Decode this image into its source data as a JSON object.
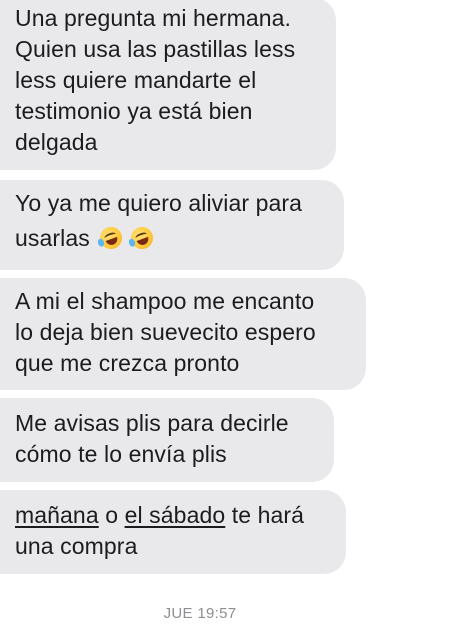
{
  "messages": [
    {
      "lines": [
        "Una pregunta mi hermana.",
        "Quien usa las pastillas less",
        "less quiere mandarte el",
        "testimonio ya está bien",
        "delgada"
      ]
    },
    {
      "lines": [
        "Yo ya me quiero aliviar para",
        "usarlas"
      ],
      "emoji": "rolling-on-floor-laughing-icon x2"
    },
    {
      "lines": [
        "A mi el shampoo me encanto",
        "lo deja bien suevecito espero",
        "que me crezca pronto"
      ]
    },
    {
      "lines": [
        "Me avisas plis para decirle",
        "cómo te lo envía plis"
      ]
    },
    {
      "line1_link1": "mañana",
      "line1_mid": " o ",
      "line1_link2": "el sábado",
      "line1_rest": " te hará",
      "line2": "una compra"
    }
  ],
  "timestamp": "JUE 19:57"
}
